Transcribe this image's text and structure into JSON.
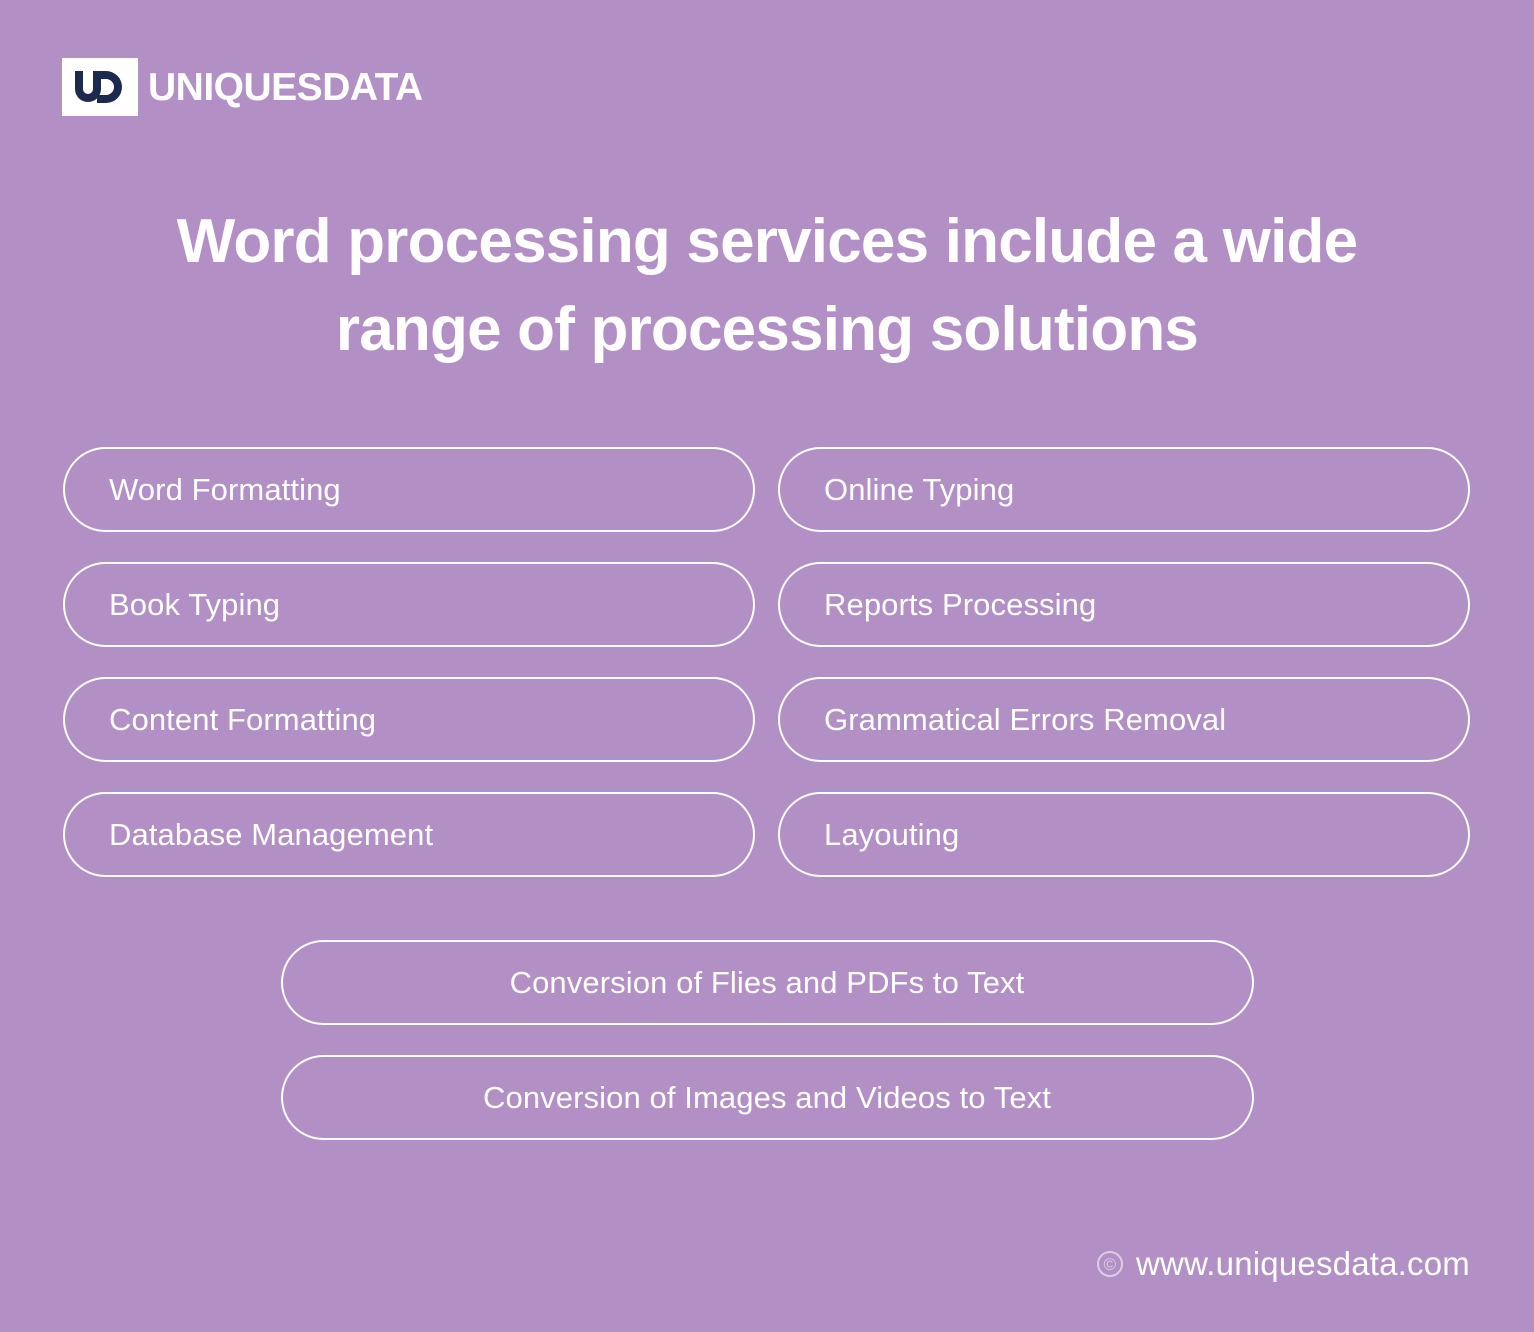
{
  "theme": {
    "background": "#b28fc5",
    "text": "#ffffff",
    "logo_mark_fill": "#1c2a4f",
    "logo_box": "#ffffff",
    "pill_border": "#ffffff"
  },
  "brand": {
    "logo_icon": "ud-monogram-icon",
    "name": "UNIQUESDATA"
  },
  "header": {
    "title": "Word processing services include a wide range of processing solutions"
  },
  "services": {
    "columns": [
      {
        "label": "Word Formatting"
      },
      {
        "label": "Online Typing"
      },
      {
        "label": "Book Typing"
      },
      {
        "label": "Reports Processing"
      },
      {
        "label": "Content Formatting"
      },
      {
        "label": "Grammatical Errors Removal"
      },
      {
        "label": "Database Management"
      },
      {
        "label": "Layouting"
      }
    ],
    "wide": [
      {
        "label": "Conversion of Flies and PDFs to Text"
      },
      {
        "label": "Conversion of Images and Videos to Text"
      }
    ]
  },
  "footer": {
    "copyright_icon": "copyright-icon",
    "copyright_symbol": "©",
    "website": "www.uniquesdata.com"
  }
}
